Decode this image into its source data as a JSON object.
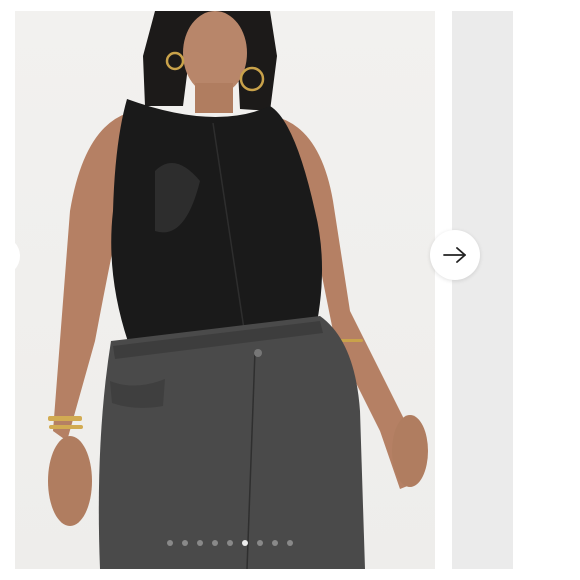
{
  "carousel": {
    "slide_count": 9,
    "active_slide_index": 5,
    "main_image_subject": "model-wearing-black-sleeveless-bodysuit-and-grey-jeans",
    "next_icon": "arrow-right-icon"
  },
  "colors": {
    "page_background": "#ffffff",
    "photo_background": "#f0efed",
    "next_slide_placeholder": "#ebebeb",
    "bodysuit": "#1a1a1a",
    "jeans": "#4a4a4a"
  }
}
